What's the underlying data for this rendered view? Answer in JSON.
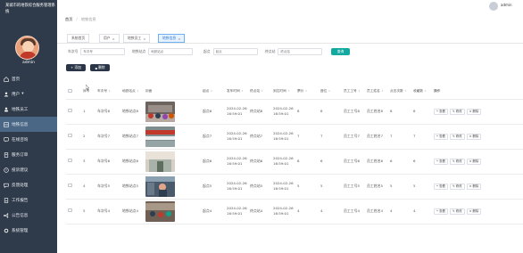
{
  "sidebar": {
    "brand": "某城市的地铁综合服务管理系统",
    "username": "admin",
    "items": [
      {
        "label": "首页",
        "icon": "home-icon"
      },
      {
        "label": "用户",
        "icon": "user-icon",
        "arrow": "▾"
      },
      {
        "label": "地铁员工",
        "icon": "staff-icon"
      },
      {
        "label": "地铁信息",
        "icon": "subway-info-icon"
      },
      {
        "label": "在线咨询",
        "icon": "consult-icon"
      },
      {
        "label": "服务订单",
        "icon": "order-icon"
      },
      {
        "label": "投诉建议",
        "icon": "complaint-icon"
      },
      {
        "label": "反馈处理",
        "icon": "feedback-icon"
      },
      {
        "label": "工作报告",
        "icon": "report-icon"
      },
      {
        "label": "公告信息",
        "icon": "notice-icon"
      },
      {
        "label": "系统管理",
        "icon": "settings-icon"
      }
    ],
    "active_index": 3
  },
  "topbar": {
    "user": "admin"
  },
  "breadcrumb": {
    "home": "首页",
    "sep": "/",
    "current": "地铁信息"
  },
  "tabs": [
    {
      "label": "系统首页",
      "closable": false
    },
    {
      "label": "用户",
      "closable": true
    },
    {
      "label": "地铁员工",
      "closable": true
    },
    {
      "label": "地铁信息",
      "closable": true,
      "active": true
    }
  ],
  "search": {
    "f1_label": "车次号",
    "f1_placeholder": "车次号",
    "f2_label": "地铁站点",
    "f2_placeholder": "地铁站点",
    "f3_label": "起点",
    "f3_placeholder": "起点",
    "f4_label": "终点站",
    "f4_placeholder": "终点站",
    "button": "查询"
  },
  "toolbar": {
    "add": "+ 添加",
    "delete": "删除"
  },
  "table": {
    "headers": [
      "序号",
      "车次号",
      "地铁站点",
      "封面",
      "起点",
      "发车时间",
      "终点站",
      "到达时间",
      "票价",
      "座位",
      "员工工号",
      "员工姓名",
      "点击次数",
      "收藏数",
      "操作"
    ],
    "rows": [
      {
        "no": "1",
        "train": "车次号8",
        "station": "地铁站点8",
        "start": "起点8",
        "dep": "2024-02-26 16:59:01",
        "end": "终点站8",
        "arr": "2024-02-26 16:59:01",
        "price": "8",
        "seat": "8",
        "eid": "员工工号8",
        "ename": "员工姓名8",
        "clicks": "8",
        "fav": "8"
      },
      {
        "no": "2",
        "train": "车次号7",
        "station": "地铁站点7",
        "start": "起点7",
        "dep": "2024-02-26 16:59:01",
        "end": "终点站7",
        "arr": "2024-02-26 16:59:01",
        "price": "7",
        "seat": "7",
        "eid": "员工工号7",
        "ename": "员工姓名7",
        "clicks": "7",
        "fav": "7"
      },
      {
        "no": "3",
        "train": "车次号6",
        "station": "地铁站点6",
        "start": "起点6",
        "dep": "2024-02-26 16:59:01",
        "end": "终点站6",
        "arr": "2024-02-26 16:59:01",
        "price": "6",
        "seat": "6",
        "eid": "员工工号6",
        "ename": "员工姓名6",
        "clicks": "6",
        "fav": "6"
      },
      {
        "no": "4",
        "train": "车次号5",
        "station": "地铁站点5",
        "start": "起点5",
        "dep": "2024-02-26 16:59:01",
        "end": "终点站5",
        "arr": "2024-02-26 16:59:01",
        "price": "5",
        "seat": "5",
        "eid": "员工工号5",
        "ename": "员工姓名5",
        "clicks": "5",
        "fav": "5"
      },
      {
        "no": "5",
        "train": "车次号4",
        "station": "地铁站点4",
        "start": "起点4",
        "dep": "2024-02-26 16:59:01",
        "end": "终点站4",
        "arr": "2024-02-26 16:59:01",
        "price": "4",
        "seat": "4",
        "eid": "员工工号4",
        "ename": "员工姓名4",
        "clicks": "4",
        "fav": "4"
      }
    ],
    "actions": {
      "view": "查看",
      "edit": "修改",
      "delete": "删除"
    }
  },
  "colors": {
    "sidebar_bg": "#2f3b4a",
    "sidebar_active": "#4a6785",
    "search_button": "#12a9a0",
    "action_button": "#2a3647",
    "active_tab": "#e6f2ff"
  }
}
